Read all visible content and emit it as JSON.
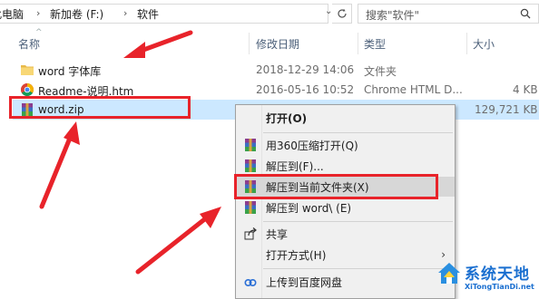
{
  "address": {
    "crumbs": [
      "此电脑",
      "新加卷 (F:)",
      "软件"
    ],
    "search_placeholder": "搜索\"软件\""
  },
  "columns": {
    "name": "名称",
    "date": "修改日期",
    "type": "类型",
    "size": "大小"
  },
  "files": [
    {
      "name": "word  字体库",
      "date": "2018-12-29 14:06",
      "type": "文件夹",
      "size": "",
      "icon": "folder-icon"
    },
    {
      "name": "Readme-说明.htm",
      "date": "2016-05-16 10:52",
      "type": "Chrome HTML D...",
      "size": "4 KB",
      "icon": "chrome-icon"
    },
    {
      "name": "word.zip",
      "date": "",
      "type": "",
      "size": "129,721 KB",
      "icon": "winrar-icon",
      "selected": true
    }
  ],
  "context_menu": {
    "open": "打开(O)",
    "open_360": "用360压缩打开(Q)",
    "extract_to": "解压到(F)...",
    "extract_here": "解压到当前文件夹(X)",
    "extract_folder": "解压到 word\\ (E)",
    "share": "共享",
    "open_with": "打开方式(H)",
    "upload_baidu": "上传到百度网盘"
  },
  "watermark": {
    "title": "系统天地",
    "subtitle": "XiTongTianDi.net"
  },
  "colors": {
    "selection": "#cce8ff",
    "annotation_red": "#e8232a",
    "folder": "#f8d775",
    "header_text": "#4c607a"
  }
}
